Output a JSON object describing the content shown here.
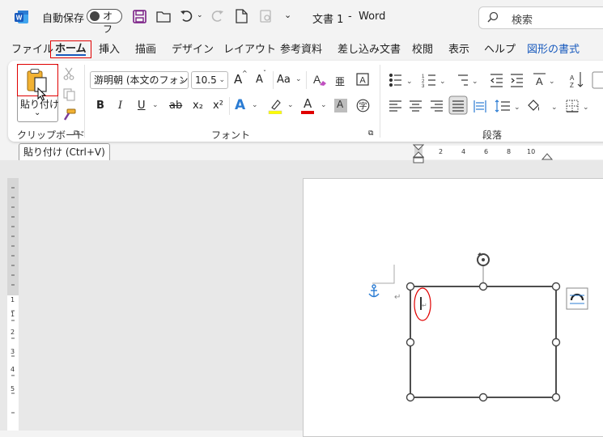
{
  "titlebar": {
    "autosave_label": "自動保存",
    "autosave_state": "オフ",
    "doc_title": "文書 1",
    "separator": "-",
    "app_name": "Word",
    "search_placeholder": "検索"
  },
  "tabs": [
    "ファイル",
    "ホーム",
    "挿入",
    "描画",
    "デザイン",
    "レイアウト",
    "参考資料",
    "差し込み文書",
    "校閲",
    "表示",
    "ヘルプ",
    "図形の書式"
  ],
  "clipboard": {
    "paste_label": "貼り付け",
    "group_label": "クリップボード"
  },
  "font": {
    "font_name": "游明朝 (本文のフォン",
    "font_size": "10.5",
    "group_label": "フォント",
    "aa_label": "Aa",
    "bold": "B",
    "italic": "I",
    "underline": "U",
    "strike": "ab",
    "subscript": "x₂",
    "superscript": "x²",
    "grow": "A",
    "shrink": "A",
    "text_effects": "A",
    "font_color": "A",
    "char_shading": "A",
    "char_border": "A",
    "phonetic": "亜"
  },
  "paragraph": {
    "group_label": "段落"
  },
  "tooltip": "貼り付け (Ctrl+V)",
  "ruler": {
    "h_numbers": [
      "2",
      "4",
      "6",
      "8",
      "10"
    ],
    "v_numbers": [
      "1",
      "1",
      "2",
      "3",
      "4",
      "5"
    ]
  },
  "colors": {
    "accent": "#185abd",
    "highlight_red": "#e00000",
    "highlighter_yellow": "#ffff00",
    "font_color_red": "#e00000"
  }
}
